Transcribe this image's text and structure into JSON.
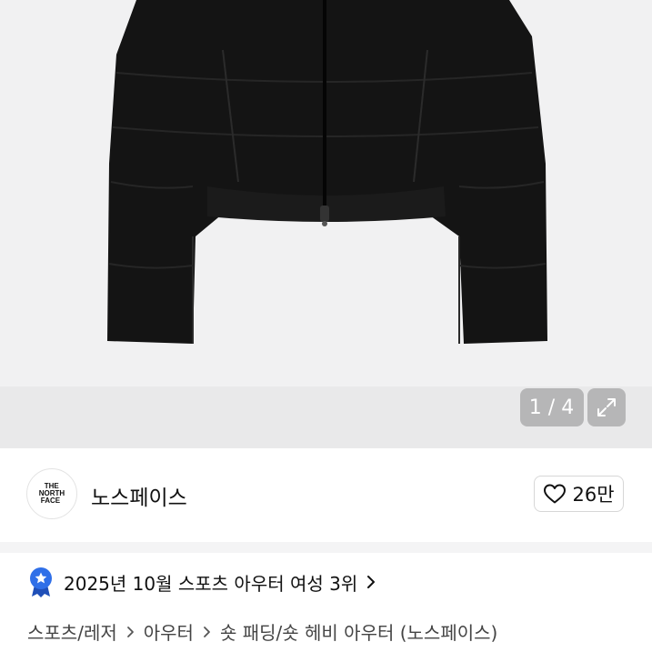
{
  "gallery": {
    "current": "1",
    "separator": "/",
    "total": "4",
    "expand_icon": "expand-icon"
  },
  "brand": {
    "logo_lines": [
      "THE",
      "NORTH",
      "FACE"
    ],
    "name": "노스페이스",
    "like_count": "26만",
    "like_icon": "heart-icon"
  },
  "ranking": {
    "badge_icon": "ribbon-badge-icon",
    "text": "2025년 10월 스포츠 아우터 여성 3위",
    "badge_color": "#2f6fe8"
  },
  "breadcrumb": [
    "스포츠/레저",
    "아우터",
    "숏 패딩/숏 헤비 아우터 (노스페이스)"
  ]
}
